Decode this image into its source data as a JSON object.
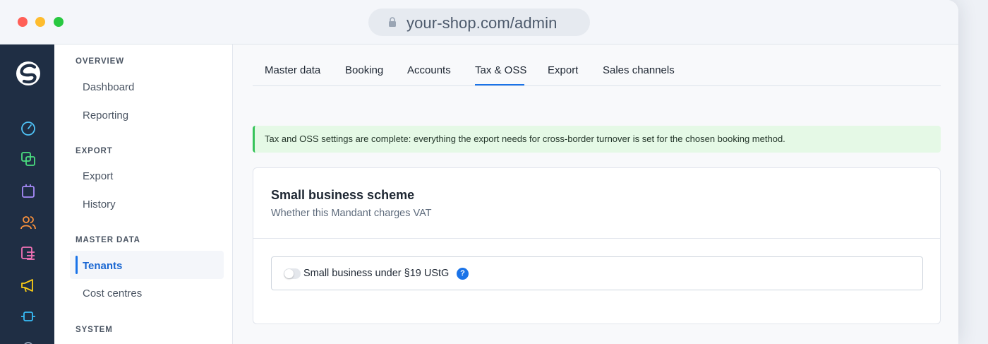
{
  "browser": {
    "url": "your-shop.com/admin"
  },
  "rail": {
    "icons": [
      "shopware-logo",
      "dashboard-gauge-icon",
      "catalogue-icon",
      "orders-bag-icon",
      "customers-icon",
      "content-icon",
      "marketing-megaphone-icon",
      "extensions-plug-icon",
      "settings-gear-icon"
    ],
    "accent_colors": [
      "#4fc3f7",
      "#4ade80",
      "#a78bfa",
      "#fb923c",
      "#f472b6",
      "#facc15",
      "#38bdf8"
    ]
  },
  "subnav": {
    "sections": [
      {
        "title": "OVERVIEW",
        "items": [
          "Dashboard",
          "Reporting"
        ]
      },
      {
        "title": "EXPORT",
        "items": [
          "Export",
          "History"
        ]
      },
      {
        "title": "MASTER DATA",
        "items": [
          "Tenants",
          "Cost centres"
        ]
      },
      {
        "title": "SYSTEM",
        "items": []
      }
    ],
    "active_item": "Tenants"
  },
  "tabs": {
    "items": [
      "Master data",
      "Booking",
      "Accounts",
      "Tax & OSS",
      "Export",
      "Sales channels"
    ],
    "active": "Tax & OSS"
  },
  "alert": {
    "text": "Tax and OSS settings are complete: everything the export needs for cross-border turnover is set for the chosen booking method."
  },
  "card": {
    "title": "Small business scheme",
    "subtitle": "Whether this Mandant charges VAT",
    "field": {
      "label": "Small business under §19 UStG",
      "help": "?",
      "toggle_on": false
    }
  },
  "colors": {
    "accent": "#1a73e8",
    "success_bg": "#e5f9e6",
    "success_border": "#37c35a",
    "rail_bg": "#1f2e44"
  }
}
